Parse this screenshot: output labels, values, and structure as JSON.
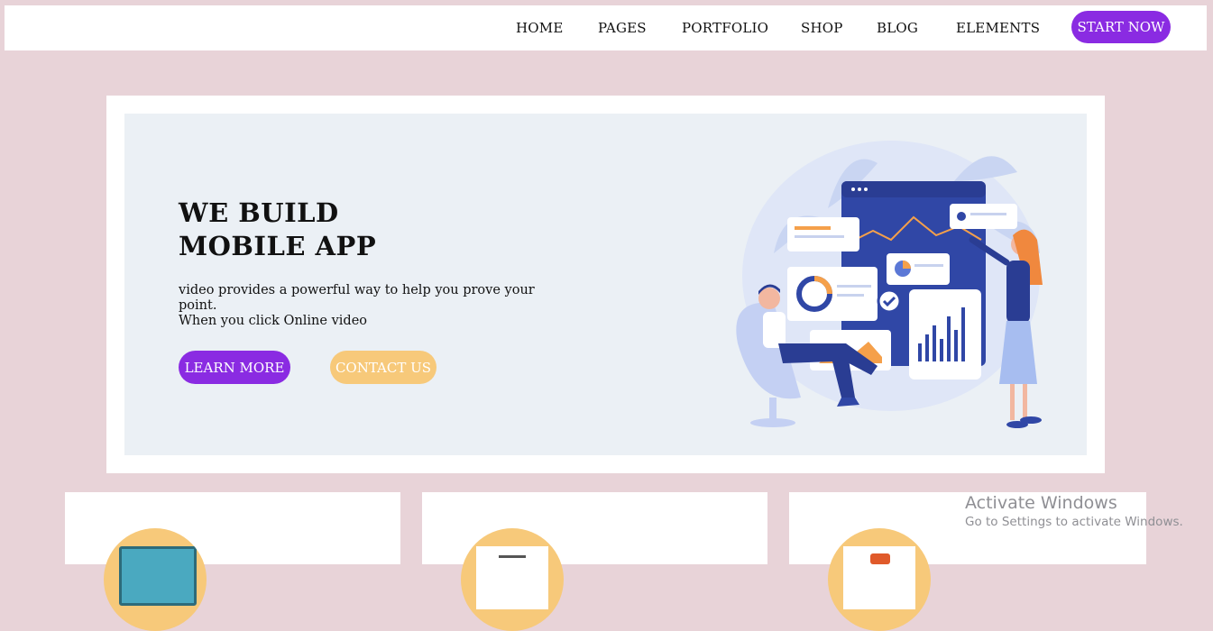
{
  "nav": {
    "items": [
      {
        "label": "HOME"
      },
      {
        "label": "PAGES"
      },
      {
        "label": "PORTFOLIO"
      },
      {
        "label": "SHOP"
      },
      {
        "label": "BLOG"
      },
      {
        "label": "ELEMENTS"
      }
    ],
    "cta_label": "START NOW"
  },
  "hero": {
    "title_line1": "WE BUILD",
    "title_line2": "MOBILE APP",
    "desc_line1": "video provides a powerful way to help you prove your point.",
    "desc_line2": "When you click Online video",
    "learn_more": "LEARN MORE",
    "contact_us": "CONTACT US",
    "illustration": "people-with-app-dashboard-illustration"
  },
  "cards": [
    {
      "icon": "laptop-icon"
    },
    {
      "icon": "document-icon"
    },
    {
      "icon": "phone-icon"
    }
  ],
  "watermark": {
    "title": "Activate Windows",
    "subtitle": "Go to Settings to activate Windows."
  },
  "colors": {
    "page_bg": "#e8d3d8",
    "accent_purple": "#8a2be2",
    "accent_orange": "#f7c97a",
    "hero_bg": "#ebf0f5"
  }
}
